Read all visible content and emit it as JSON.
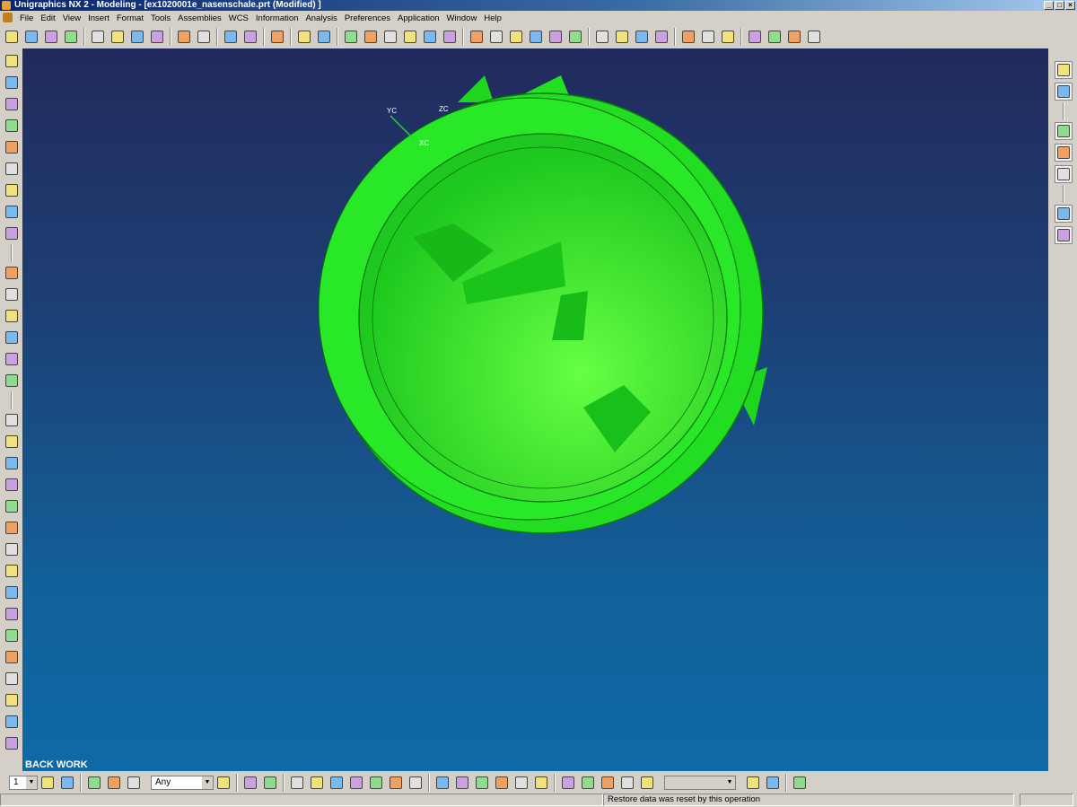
{
  "window": {
    "title": "Unigraphics NX 2 - Modeling - [ex1020001e_nasenschale.prt (Modified) ]",
    "controls": [
      "_",
      "□",
      "×"
    ]
  },
  "menu": [
    "File",
    "Edit",
    "View",
    "Insert",
    "Format",
    "Tools",
    "Assemblies",
    "WCS",
    "Information",
    "Analysis",
    "Preferences",
    "Application",
    "Window",
    "Help"
  ],
  "top_toolbar": [
    "new-icon",
    "open-icon",
    "save-icon",
    "print-icon",
    "|",
    "cut-icon",
    "copy-icon",
    "paste-icon",
    "delete-icon",
    "|",
    "undo-icon",
    "repeat-command-icon",
    "|",
    "assembly-icon",
    "add-component-icon",
    "|",
    "load-part-icon",
    "|",
    "reference-set-icon",
    "unload-icon",
    "|",
    "point-icon",
    "arc-icon",
    "spline-icon",
    "plus-point-icon",
    "point-set-icon",
    "rectangle-icon",
    "|",
    "ellipse-icon",
    "extrude-icon",
    "revolve-icon",
    "sweep-icon",
    "mirror-icon",
    "draft-icon",
    "|",
    "inspect-icon",
    "trim-icon",
    "curve-icon",
    "bridge-icon",
    "|",
    "zoom-icon",
    "rotate-icon",
    "pan-icon",
    "|",
    "wireframe-icon",
    "shaded-icon",
    "color-icon",
    "layer-icon"
  ],
  "left_toolbar": [
    "sketch-icon",
    "datum-icon",
    "feature-icon",
    "hole-icon",
    "boss-icon",
    "pocket-icon",
    "pad-icon",
    "slot-icon",
    "cylinder-icon",
    "|",
    "blend-icon",
    "chamfer-icon",
    "shell-icon",
    "block-icon",
    "cone-icon",
    "sphere-icon",
    "|",
    "face-icon",
    "body-icon",
    "offset-icon",
    "trim-body-icon",
    "thicken-icon",
    "sew-icon",
    "pattern-icon",
    "section-icon",
    "thread-icon",
    "instance-icon",
    "unite-icon",
    "subtract-icon",
    "intersect-icon",
    "extract-icon",
    "promote-icon",
    "wrap-icon"
  ],
  "right_toolbar": [
    "assembly-navigator-icon",
    "part-navigator-icon",
    "|",
    "history-icon",
    "training-icon",
    "help-icon",
    "|",
    "clock-icon",
    "info-window-icon"
  ],
  "viewport": {
    "label": "BACK WORK",
    "axes": {
      "x": "XC",
      "y": "YC",
      "z": "ZC"
    },
    "model_color": "#22ee22",
    "background_top": "#222a5c",
    "background_bottom": "#0e6aa6"
  },
  "bottom_toolbar": {
    "layer_value": "1",
    "filter_value": "Any",
    "icons_a": [
      "layer-settings-icon",
      "wcs-icon",
      "|",
      "snap-point-icon",
      "select-icon",
      "wireframe-box-icon"
    ],
    "icons_b": [
      "reset-filter-icon",
      "|",
      "fea-icon",
      "sketch-point-icon",
      "|",
      "line-icon",
      "line2-icon",
      "curve-end-icon",
      "normal-icon",
      "center-icon",
      "circle-icon",
      "plus-icon",
      "|",
      "binoculars-icon",
      "open-part-icon",
      "component-icon",
      "rotate-component-icon",
      "camera-icon",
      "clipboard-icon",
      "|",
      "add-existing-icon",
      "mirror-component-icon",
      "reposition-icon",
      "constraint-icon",
      "wave-icon"
    ],
    "icons_c": [
      "part-family-icon",
      "link-icon",
      "|",
      "check-icon"
    ]
  },
  "status": {
    "message": "Restore data was reset by this operation"
  }
}
